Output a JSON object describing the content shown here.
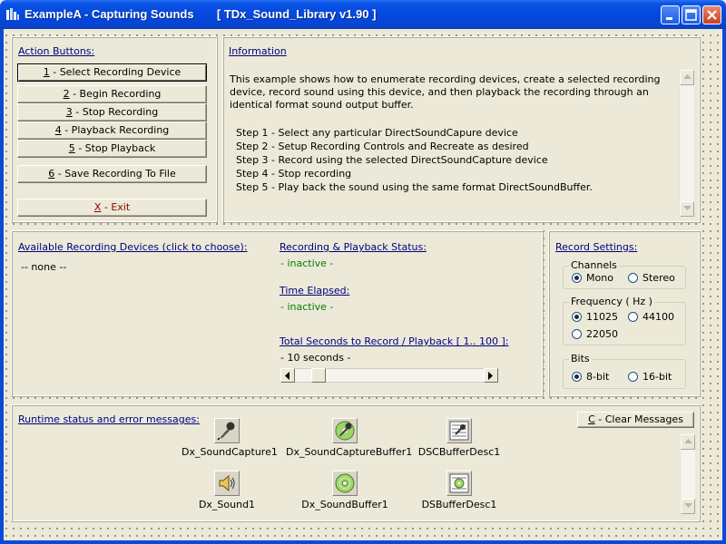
{
  "window": {
    "title": "ExampleA - Capturing Sounds       [ TDx_Sound_Library v1.90 ]"
  },
  "actions": {
    "label": "Action Buttons:",
    "buttons": [
      {
        "key": "1",
        "text": " - Select Recording Device"
      },
      {
        "key": "2",
        "text": " - Begin Recording"
      },
      {
        "key": "3",
        "text": " - Stop Recording"
      },
      {
        "key": "4",
        "text": " - Playback Recording"
      },
      {
        "key": "5",
        "text": " - Stop Playback"
      },
      {
        "key": "6",
        "text": " - Save Recording To File"
      },
      {
        "key": "X",
        "text": " - Exit"
      }
    ]
  },
  "information": {
    "label": "Information",
    "intro": "This example shows how to enumerate recording devices, create a selected recording device, record sound using this device, and then playback the recording through an identical format sound output buffer.",
    "steps": [
      "Step 1 - Select any particular DirectSoundCapure device",
      "Step 2 - Setup Recording Controls and Recreate as desired",
      "Step 3 - Record using the selected DirectSoundCapture device",
      "Step 4 - Stop recording",
      "Step 5 - Play back the sound using the same format DirectSoundBuffer."
    ]
  },
  "devices": {
    "label": "Available Recording Devices (click to choose):",
    "value": "-- none --"
  },
  "status": {
    "label": "Recording & Playback Status:",
    "value": "- inactive -",
    "elapsed_label": "Time Elapsed:",
    "elapsed_value": "- inactive -",
    "seconds_label": "Total Seconds to Record / Playback [ 1.. 100 ]:",
    "seconds_value": "- 10 seconds -",
    "seconds_slider": {
      "min": 1,
      "max": 100,
      "value": 10
    }
  },
  "record_settings": {
    "label": "Record Settings:",
    "channels": {
      "label": "Channels",
      "options": [
        "Mono",
        "Stereo"
      ],
      "selected": "Mono"
    },
    "frequency": {
      "label": "Frequency ( Hz )",
      "options": [
        "11025",
        "44100",
        "22050"
      ],
      "selected": "11025"
    },
    "bits": {
      "label": "Bits",
      "options": [
        "8-bit",
        "16-bit"
      ],
      "selected": "8-bit"
    }
  },
  "runtime": {
    "label": "Runtime status and error messages:",
    "clear_key": "C",
    "clear_text": " - Clear Messages",
    "components": [
      {
        "name": "Dx_SoundCapture1",
        "icon": "microphone-icon"
      },
      {
        "name": "Dx_SoundCaptureBuffer1",
        "icon": "microphone-cd-icon"
      },
      {
        "name": "DSCBufferDesc1",
        "icon": "capture-buffer-desc-icon"
      },
      {
        "name": "Dx_Sound1",
        "icon": "speaker-icon"
      },
      {
        "name": "Dx_SoundBuffer1",
        "icon": "cd-icon"
      },
      {
        "name": "DSBufferDesc1",
        "icon": "buffer-desc-icon"
      }
    ]
  },
  "colors": {
    "titlebar": "#0548dd",
    "link": "#000080",
    "status_green": "#008000",
    "exit_red": "#8b0000"
  }
}
